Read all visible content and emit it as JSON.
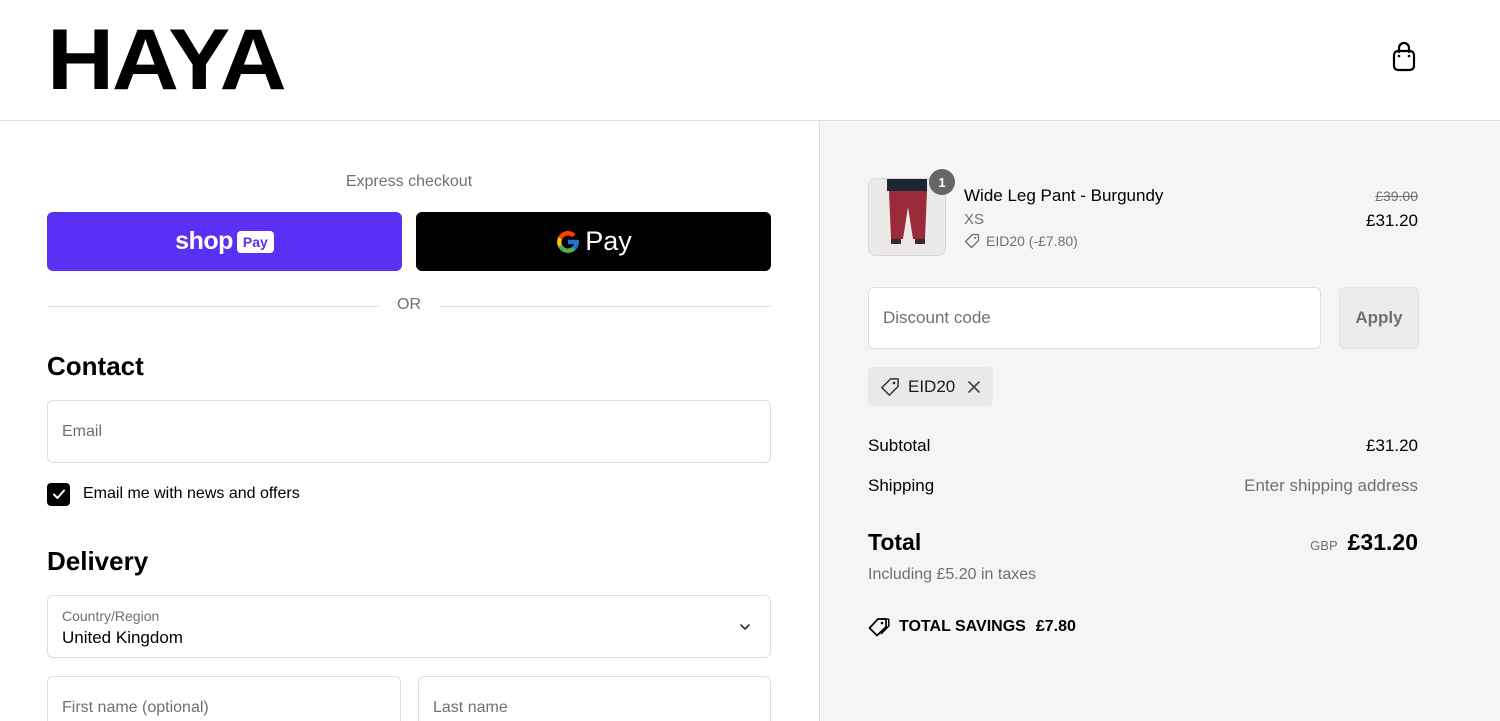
{
  "header": {
    "logo": "HAYA",
    "cart_icon": "shopping-bag-icon"
  },
  "express": {
    "label": "Express checkout",
    "shop_pay": {
      "word": "shop",
      "badge": "Pay",
      "color": "#5a31f4"
    },
    "gpay": {
      "text": "Pay",
      "icon": "google-g-icon"
    },
    "or_label": "OR"
  },
  "contact": {
    "title": "Contact",
    "email_placeholder": "Email",
    "newsletter_label": "Email me with news and offers",
    "newsletter_checked": true
  },
  "delivery": {
    "title": "Delivery",
    "country_label": "Country/Region",
    "country_value": "United Kingdom",
    "first_name_placeholder": "First name (optional)",
    "last_name_placeholder": "Last name"
  },
  "summary": {
    "item": {
      "name": "Wide Leg Pant - Burgundy",
      "variant": "XS",
      "quantity": "1",
      "discount_line": "EID20 (-£7.80)",
      "price_original": "£39.00",
      "price_final": "£31.20",
      "image_icon": "product-thumbnail"
    },
    "discount_placeholder": "Discount code",
    "apply_label": "Apply",
    "applied_code": "EID20",
    "subtotal_label": "Subtotal",
    "subtotal_value": "£31.20",
    "shipping_label": "Shipping",
    "shipping_value": "Enter shipping address",
    "total_label": "Total",
    "currency": "GBP",
    "total_value": "£31.20",
    "taxes_note": "Including £5.20 in taxes",
    "savings_label": "TOTAL SAVINGS",
    "savings_value": "£7.80"
  },
  "colors": {
    "accent_shop_pay": "#5a31f4",
    "panel_bg": "#f5f5f5",
    "muted_text": "#707070",
    "border": "#dedede"
  }
}
